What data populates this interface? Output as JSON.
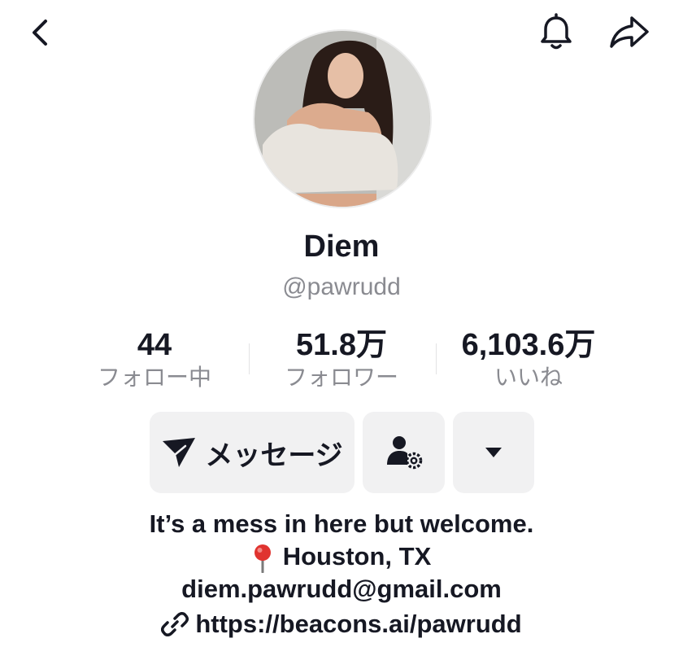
{
  "topbar": {
    "back_icon": "chevron-left-icon",
    "notification_icon": "bell-icon",
    "share_icon": "share-arrow-icon"
  },
  "profile": {
    "display_name": "Diem",
    "username": "@pawrudd"
  },
  "stats": [
    {
      "value": "44",
      "label": "フォロー中"
    },
    {
      "value": "51.8万",
      "label": "フォロワー"
    },
    {
      "value": "6,103.6万",
      "label": "いいね"
    }
  ],
  "actions": {
    "message_label": "メッセージ",
    "message_icon": "send-icon",
    "friend_icon": "user-settings-icon",
    "more_icon": "caret-down-icon"
  },
  "bio": {
    "line1": "It’s a mess in here but welcome.",
    "location_icon": "pin-icon",
    "line2": "Houston, TX",
    "line3": "diem.pawrudd@gmail.com",
    "link_icon": "link-icon",
    "link": "https://beacons.ai/pawrudd"
  },
  "colors": {
    "text_primary": "#161823",
    "text_secondary": "#8a8b91",
    "button_bg": "#f1f1f2",
    "pin_red": "#e0332f"
  }
}
